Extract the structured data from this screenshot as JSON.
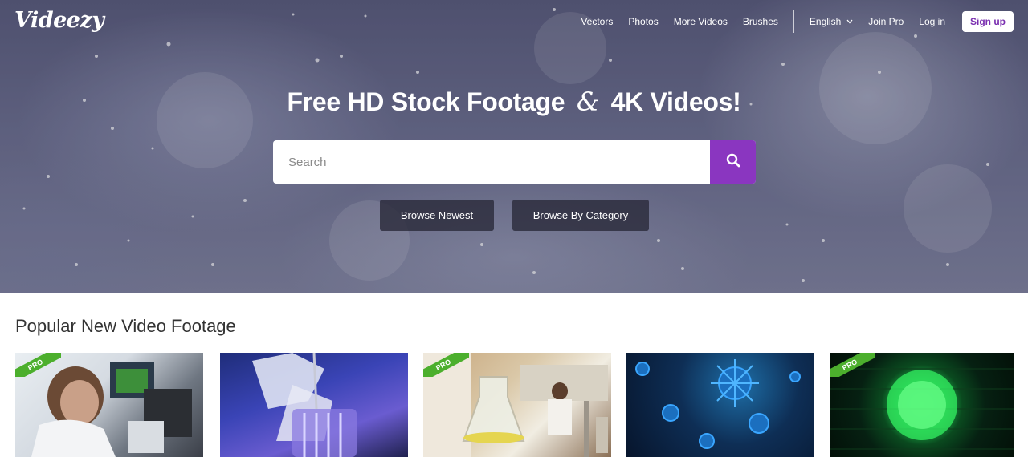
{
  "brand": {
    "logo": "Videezy"
  },
  "nav": {
    "items": [
      "Vectors",
      "Photos",
      "More Videos",
      "Brushes"
    ],
    "language": "English",
    "join_pro": "Join Pro",
    "login": "Log in",
    "signup": "Sign up"
  },
  "hero": {
    "headline_part1": "Free HD Stock Footage",
    "headline_amp": "&",
    "headline_part2": "4K Videos!",
    "search_placeholder": "Search",
    "browse_newest": "Browse Newest",
    "browse_category": "Browse By Category"
  },
  "section": {
    "title": "Popular New Video Footage"
  },
  "thumbnails": [
    {
      "pro": true,
      "pro_label": "PRO"
    },
    {
      "pro": false
    },
    {
      "pro": true,
      "pro_label": "PRO"
    },
    {
      "pro": false
    },
    {
      "pro": true,
      "pro_label": "PRO"
    }
  ],
  "colors": {
    "accent_purple": "#8a36c0",
    "pro_green": "#4caf2d",
    "signup_text": "#7a2fb0"
  },
  "icons": {
    "search": "search-icon",
    "language_dropdown": "chevron-down-icon"
  }
}
